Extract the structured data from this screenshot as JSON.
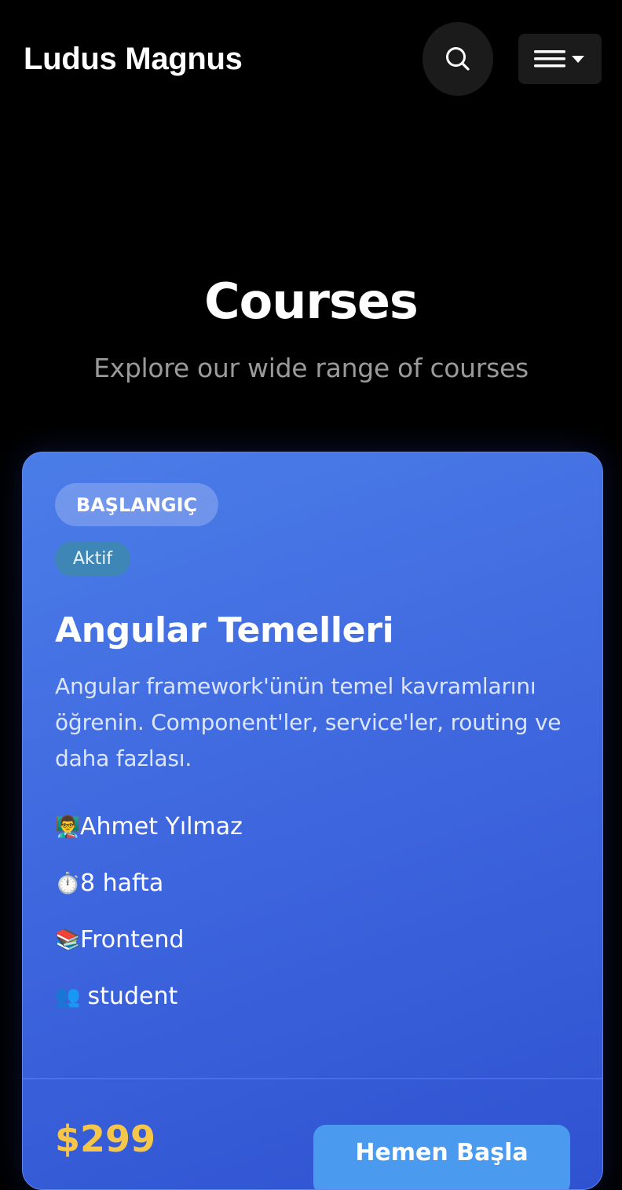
{
  "header": {
    "brand": "Ludus Magnus",
    "search_icon": "search-icon",
    "menu_icon": "hamburger-menu-icon"
  },
  "hero": {
    "title": "Courses",
    "subtitle": "Explore our wide range of courses"
  },
  "course": {
    "level": "BAŞLANGIÇ",
    "status": "Aktif",
    "title": "Angular Temelleri",
    "description": "Angular framework'ünün temel kavramlarını öğrenin. Component'ler, service'ler, routing ve daha fazlası.",
    "instructor_icon": "👨‍🏫",
    "instructor": "Ahmet Yılmaz",
    "duration_icon": "⏱️",
    "duration": "8 hafta",
    "category_icon": "📚",
    "category": "Frontend",
    "students_icon": "👥",
    "students": " student",
    "price": "$299",
    "cta_label": "Hemen Başla"
  },
  "colors": {
    "background": "#000000",
    "card_start": "#4b7de8",
    "card_end": "#2f52d1",
    "price": "#f6c64a",
    "cta": "#4a9af0",
    "status_badge": "#3d86b6"
  }
}
